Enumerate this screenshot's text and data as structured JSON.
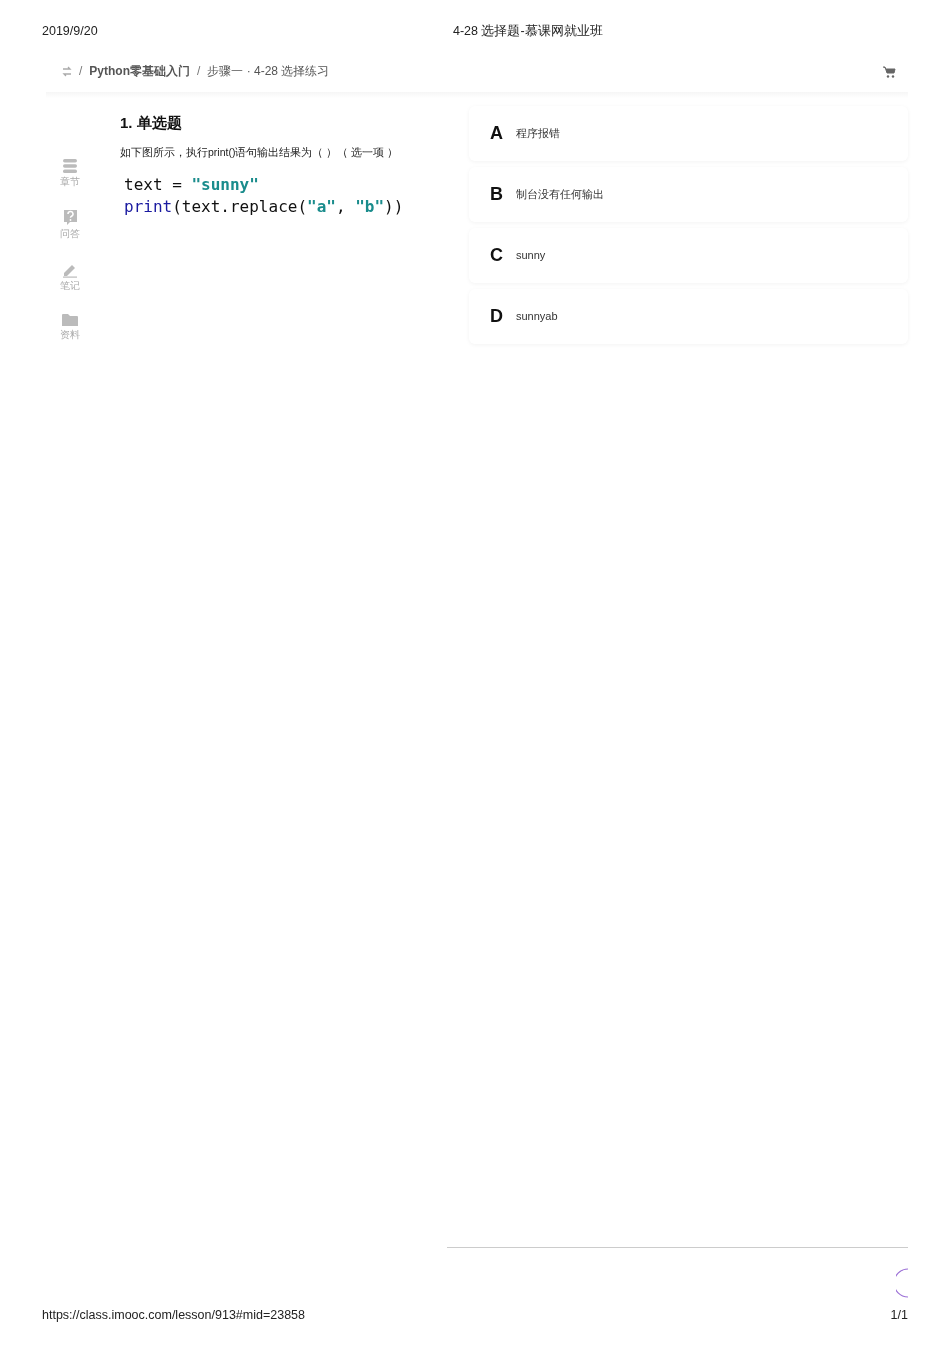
{
  "print_header": {
    "date": "2019/9/20",
    "title": "4-28 选择题-慕课网就业班"
  },
  "breadcrumb": [
    {
      "separator": "/",
      "text": "Python零基础入门",
      "kind": "link"
    },
    {
      "separator": "/",
      "text": "步骤一 · 4-28 选择练习",
      "kind": "current"
    }
  ],
  "sidebar": {
    "items": [
      {
        "label": "章节",
        "kind": "chapters"
      },
      {
        "label": "问答",
        "kind": "qa"
      },
      {
        "label": "笔记",
        "kind": "notes"
      },
      {
        "label": "资料",
        "kind": "files"
      }
    ]
  },
  "question": {
    "title": "1. 单选题",
    "prompt": "如下图所示，执行print()语句输出结果为（  ）（ 选一项 ）",
    "code": [
      [
        {
          "text": "text = ",
          "kind": "plain"
        },
        {
          "text": "\"sunny\"",
          "kind": "string"
        }
      ],
      [
        {
          "text": "print",
          "kind": "builtin"
        },
        {
          "text": "(text.replace(",
          "kind": "plain"
        },
        {
          "text": "\"a\"",
          "kind": "string"
        },
        {
          "text": ", ",
          "kind": "plain"
        },
        {
          "text": "\"b\"",
          "kind": "string"
        },
        {
          "text": "))",
          "kind": "plain"
        }
      ]
    ]
  },
  "options": [
    {
      "letter": "A",
      "text": "程序报错"
    },
    {
      "letter": "B",
      "text": "制台没有任何输出"
    },
    {
      "letter": "C",
      "text": "sunny"
    },
    {
      "letter": "D",
      "text": "sunnyab"
    }
  ],
  "print_footer": {
    "url": "https://class.imooc.com/lesson/913#mid=23858",
    "page": "1/1"
  }
}
